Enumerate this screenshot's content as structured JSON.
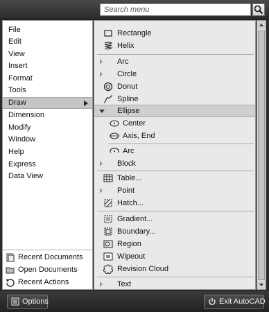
{
  "search": {
    "placeholder": "Search menu"
  },
  "left_menu": [
    {
      "label": "File"
    },
    {
      "label": "Edit"
    },
    {
      "label": "View"
    },
    {
      "label": "Insert"
    },
    {
      "label": "Format"
    },
    {
      "label": "Tools"
    },
    {
      "label": "Draw",
      "active": true
    },
    {
      "label": "Dimension"
    },
    {
      "label": "Modify"
    },
    {
      "label": "Window"
    },
    {
      "label": "Help"
    },
    {
      "label": "Express"
    },
    {
      "label": "Data View"
    }
  ],
  "recent": [
    {
      "label": "Recent Documents",
      "icon": "recent-documents-icon"
    },
    {
      "label": "Open Documents",
      "icon": "open-documents-icon"
    },
    {
      "label": "Recent Actions",
      "icon": "recent-actions-icon"
    }
  ],
  "draw_submenu": {
    "rectangle": "Rectangle",
    "helix": "Helix",
    "arc": "Arc",
    "circle": "Circle",
    "donut": "Donut",
    "spline": "Spline",
    "ellipse": "Ellipse",
    "ellipse_center": "Center",
    "ellipse_axis_end": "Axis, End",
    "ellipse_arc": "Arc",
    "block": "Block",
    "table": "Table...",
    "point": "Point",
    "hatch": "Hatch...",
    "gradient": "Gradient...",
    "boundary": "Boundary...",
    "region": "Region",
    "wipeout": "Wipeout",
    "revision_cloud": "Revision Cloud",
    "text": "Text"
  },
  "bottom": {
    "options": "Options",
    "exit": "Exit AutoCAD"
  }
}
